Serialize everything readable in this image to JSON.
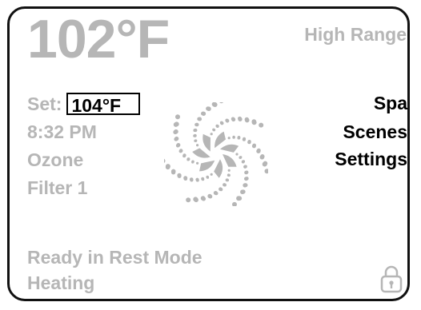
{
  "display": {
    "current_temperature": "102°F",
    "range": "High Range",
    "set_label": "Set:",
    "set_temperature": "104°F",
    "time": "8:32 PM",
    "ozone": "Ozone",
    "filter": "Filter 1"
  },
  "menu": {
    "spa": "Spa",
    "scenes": "Scenes",
    "settings": "Settings"
  },
  "status": {
    "mode": "Ready in Rest Mode",
    "heater": "Heating"
  },
  "icons": {
    "swirl": "jets-swirl-icon",
    "lock": "padlock-icon"
  },
  "colors": {
    "text_dim": "#b6b6b6",
    "text_active": "#000000",
    "frame": "#111111"
  }
}
